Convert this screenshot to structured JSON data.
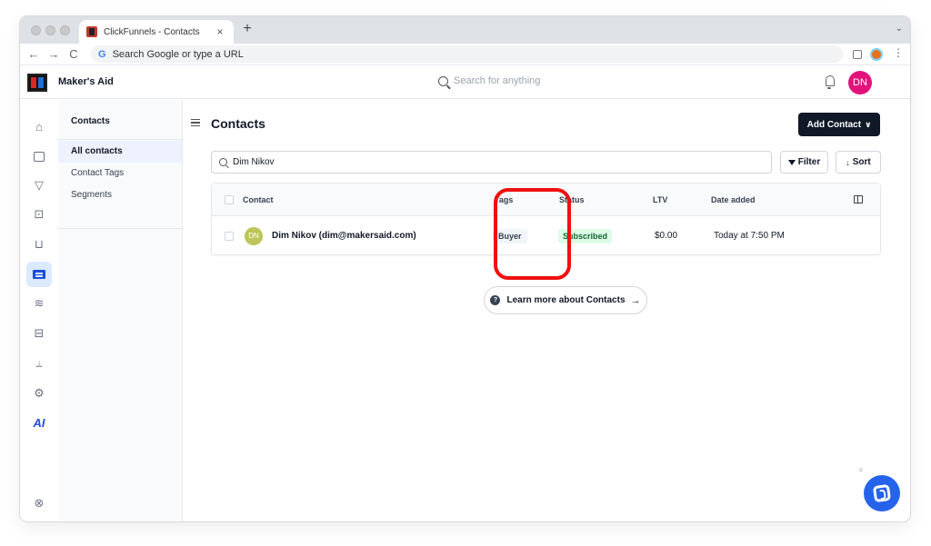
{
  "browser": {
    "tab_title": "ClickFunnels - Contacts",
    "tab_close": "×",
    "new_tab": "+",
    "address_placeholder": "Search Google or type a URL",
    "back": "←",
    "forward": "→",
    "reload": "C",
    "google_letter": "G",
    "menu": "⋮",
    "tab_menu": "⌄"
  },
  "app": {
    "org_name": "Maker's Aid",
    "search_placeholder": "Search for anything",
    "user_initials": "DN",
    "avatar_color": "#e2137a"
  },
  "rail": {
    "icons": [
      "home-icon",
      "page-icon",
      "funnel-icon",
      "store-icon",
      "cart-icon",
      "contacts-icon",
      "analytics-icon",
      "email-icon",
      "automation-icon",
      "settings-icon",
      "ai-icon",
      "support-icon"
    ],
    "ai_label": "AI"
  },
  "subnav": {
    "header": "Contacts",
    "items": [
      "All contacts",
      "Contact Tags",
      "Segments"
    ],
    "active_index": 0
  },
  "page": {
    "title": "Contacts",
    "add_button": "Add Contact",
    "add_button_chevron": "∨",
    "search_value": "Dim Nikov",
    "filter_label": "Filter",
    "sort_label": "Sort",
    "sort_icon": "↓",
    "learn_more": "Learn more about Contacts",
    "learn_more_arrow": "→",
    "learn_more_icon": "?"
  },
  "table": {
    "columns": [
      "Contact",
      "Tags",
      "Status",
      "LTV",
      "Date added"
    ],
    "rows": [
      {
        "initials": "DN",
        "contact": "Dim Nikov (dim@makersaid.com)",
        "tag": "Buyer",
        "status": "Subscribed",
        "ltv": "$0.00",
        "date_added": "Today at 7:50 PM"
      }
    ]
  },
  "colors": {
    "accent": "#1d4ed8",
    "highlight": "#ef1010",
    "status_bg": "#dcfce7",
    "dark_button": "#111827"
  }
}
